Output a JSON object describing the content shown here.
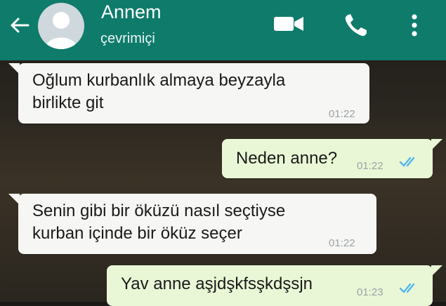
{
  "header": {
    "contact_name": "Annem",
    "status": "çevrimiçi",
    "icons": [
      "back-arrow-icon",
      "avatar",
      "video-call-icon",
      "phone-icon",
      "more-options-icon"
    ],
    "color": "#0e7b6b"
  },
  "messages": [
    {
      "direction": "incoming",
      "line1": "Oğlum kurbanlık almaya beyzayla",
      "line2": "birlikte git",
      "time": "01:22"
    },
    {
      "direction": "outgoing",
      "line1": "Neden anne?",
      "time": "01:22",
      "read": true
    },
    {
      "direction": "incoming",
      "line1": "Senin gibi bir öküzü nasıl seçtiyse",
      "line2": "kurban içinde bir öküz seçer",
      "time": "01:22"
    },
    {
      "direction": "outgoing",
      "line1": "Yav anne aşjdşkfsşkdşsjn",
      "time": "01:23",
      "read": true
    }
  ],
  "colors": {
    "incoming_bubble": "#f6f6f4",
    "outgoing_bubble": "#e9f7d6",
    "read_ticks": "#4fb7f0"
  }
}
